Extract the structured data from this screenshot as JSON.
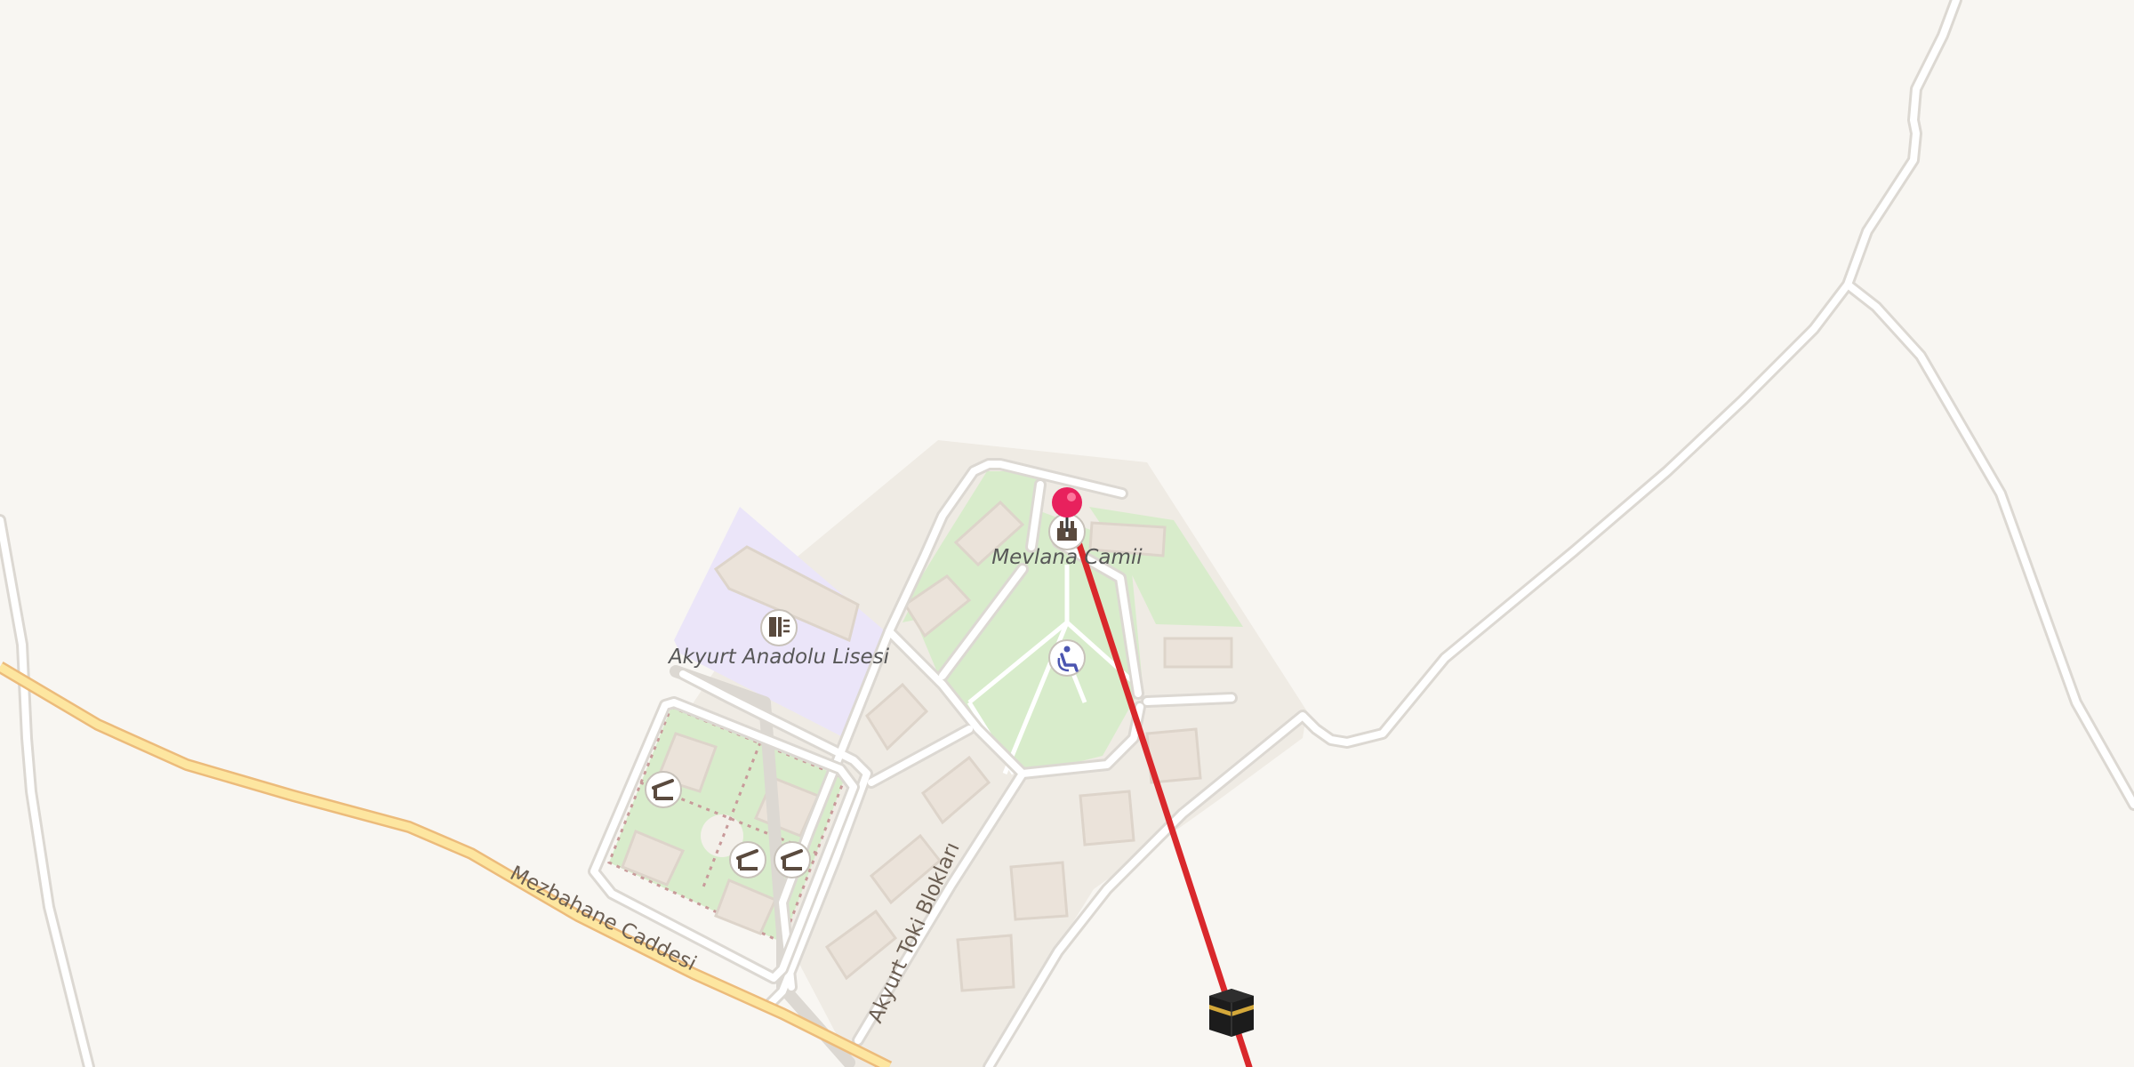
{
  "map": {
    "background_color": "#f8f6f2",
    "poi_labels": {
      "mosque": "Mevlana Camii",
      "school": "Akyurt Anadolu Lisesi"
    },
    "street_labels": {
      "main_road": "Mezbahane Caddesi",
      "side_street": "Akyurt Toki Blokları"
    },
    "icons": {
      "mosque": "mosque-icon",
      "school": "school-icon",
      "sit_area": "person-sitting-icon",
      "shelter": "shelter-icon",
      "location_pin": "location-pin-icon",
      "kaaba": "kaaba-icon"
    },
    "colors": {
      "land": "#f8f6f2",
      "residential": "#efebe4",
      "park": "#d8eccb",
      "school_area": "#ebe5f9",
      "building": "#ebe3da",
      "road": "#ffffff",
      "road_casing": "#dcd8d2",
      "primary_road": "#fde6a0",
      "primary_road_casing": "#ecbb7b",
      "qibla_line": "#d9282c",
      "pin": "#e8215d"
    }
  }
}
